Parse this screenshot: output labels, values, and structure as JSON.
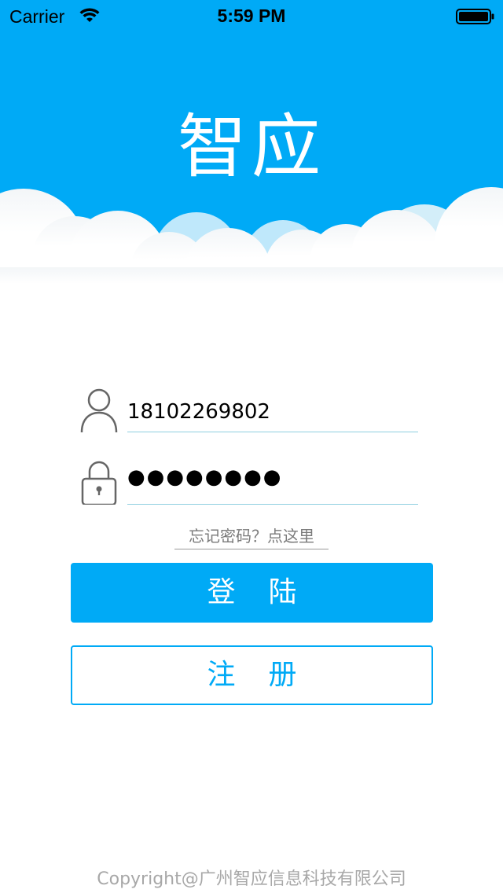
{
  "status_bar": {
    "carrier": "Carrier",
    "time": "5:59 PM",
    "icons": [
      "wifi-icon",
      "battery-icon"
    ]
  },
  "header": {
    "logo_text": "智应",
    "background_color": "#00aaf6",
    "logo_color": "#ffffff"
  },
  "login_form": {
    "username": {
      "value": "18102269802",
      "icon": "user-icon"
    },
    "password": {
      "masked_value": "●●●●●●●●",
      "icon": "lock-icon"
    },
    "forgot_password_link": "忘记密码？点这里",
    "login_button": "登陆",
    "register_button": "注册"
  },
  "footer": {
    "copyright": "Copyright@广州智应信息科技有限公司"
  },
  "colors": {
    "accent": "#00aaf6",
    "input_underline": "#8fd0e0",
    "muted_text": "#a8a8a8"
  }
}
